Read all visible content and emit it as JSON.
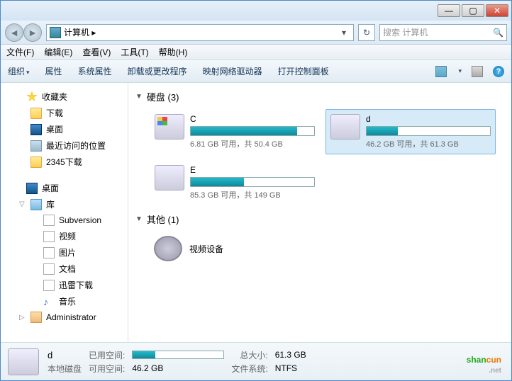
{
  "titlebar": {
    "min": "—",
    "max": "▢",
    "close": "✕"
  },
  "address": {
    "computer_icon": "computer",
    "path": "计算机 ▸",
    "dropdown": "▾",
    "refresh": "↻"
  },
  "search": {
    "placeholder": "搜索 计算机",
    "icon": "🔍"
  },
  "menubar": [
    "文件(F)",
    "编辑(E)",
    "查看(V)",
    "工具(T)",
    "帮助(H)"
  ],
  "toolbar": {
    "items": [
      "组织",
      "属性",
      "系统属性",
      "卸载或更改程序",
      "映射网络驱动器",
      "打开控制面板"
    ],
    "help": "?"
  },
  "sidebar": {
    "favorites": {
      "label": "收藏夹",
      "children": [
        {
          "label": "下载",
          "icon": "folder"
        },
        {
          "label": "桌面",
          "icon": "monitor"
        },
        {
          "label": "最近访问的位置",
          "icon": "recent"
        },
        {
          "label": "2345下载",
          "icon": "folder"
        }
      ]
    },
    "desktop": {
      "label": "桌面",
      "children": [
        {
          "label": "库",
          "icon": "lib",
          "children": [
            {
              "label": "Subversion",
              "icon": "doc"
            },
            {
              "label": "视频",
              "icon": "doc"
            },
            {
              "label": "图片",
              "icon": "doc"
            },
            {
              "label": "文档",
              "icon": "doc"
            },
            {
              "label": "迅雷下载",
              "icon": "doc"
            },
            {
              "label": "音乐",
              "icon": "music"
            }
          ]
        },
        {
          "label": "Administrator",
          "icon": "user"
        }
      ]
    }
  },
  "content": {
    "hdd_section": "硬盘 (3)",
    "other_section": "其他 (1)",
    "drives": [
      {
        "name": "C",
        "free": "6.81 GB",
        "total": "50.4 GB",
        "fill": 86,
        "winlogo": true,
        "selected": false
      },
      {
        "name": "d",
        "free": "46.2 GB",
        "total": "61.3 GB",
        "fill": 25,
        "winlogo": false,
        "selected": true
      },
      {
        "name": "E",
        "free": "85.3 GB",
        "total": "149 GB",
        "fill": 43,
        "winlogo": false,
        "selected": false
      }
    ],
    "stats_template": " 可用，共 ",
    "other_label": "视频设备"
  },
  "details": {
    "name": "d",
    "subtitle": "本地磁盘",
    "used_label": "已用空间:",
    "free_label": "可用空间:",
    "free_value": "46.2 GB",
    "total_label": "总大小:",
    "total_value": "61.3 GB",
    "fs_label": "文件系统:",
    "fs_value": "NTFS",
    "fill": 25
  },
  "watermark": {
    "text1": "shan",
    "text2": "cun",
    "sub": ".net"
  }
}
